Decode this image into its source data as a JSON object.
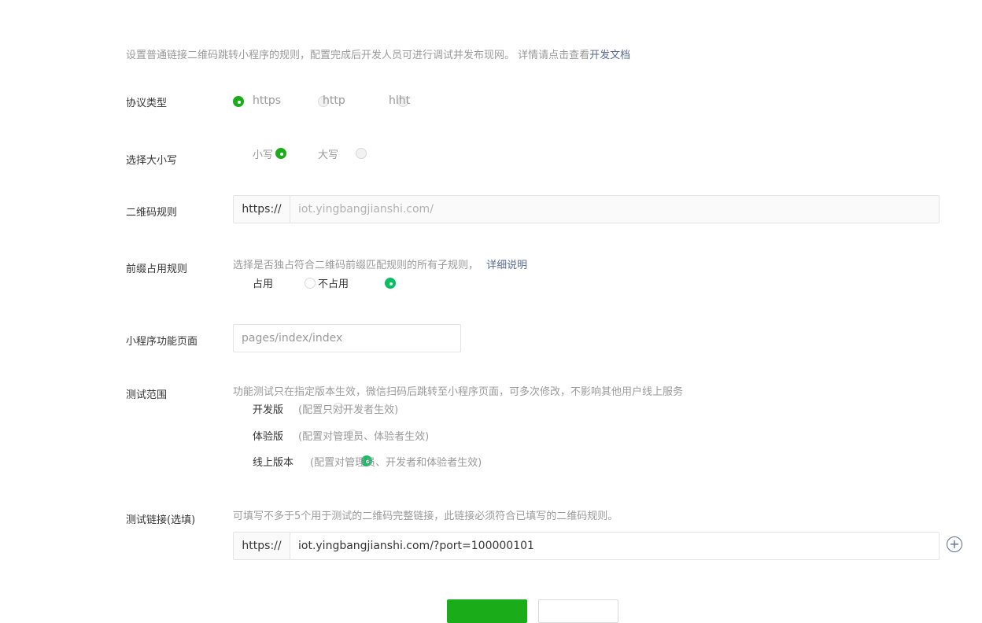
{
  "intro": {
    "text": "设置普通链接二维码跳转小程序的规则，配置完成后开发人员可进行调试并发布现网。 详情请点击查看",
    "link": "开发文档"
  },
  "protocol": {
    "label": "协议类型",
    "options": [
      "https",
      "http",
      "hlht"
    ],
    "selected": "https"
  },
  "case": {
    "label": "选择大小写",
    "options": [
      "小写",
      "大写"
    ],
    "selected": "小写"
  },
  "qr_rule": {
    "label": "二维码规则",
    "prefix": "https://",
    "value": "iot.yingbangjianshi.com/"
  },
  "prefix_rule": {
    "label": "前缀占用规则",
    "hint": "选择是否独占符合二维码前缀匹配规则的所有子规则，",
    "hint_link": "详细说明",
    "options": [
      "占用",
      "不占用"
    ],
    "selected": "不占用"
  },
  "page": {
    "label": "小程序功能页面",
    "placeholder": "pages/index/index"
  },
  "test_scope": {
    "label": "测试范围",
    "hint": "功能测试只在指定版本生效，微信扫码后跳转至小程序页面，可多次修改，不影响其他用户线上服务",
    "options": [
      {
        "label": "开发版",
        "desc": "(配置只对开发者生效)"
      },
      {
        "label": "体验版",
        "desc": "(配置对管理员、体验者生效)"
      },
      {
        "label": "线上版本",
        "desc": "(配置对管理员、开发者和体验者生效)"
      }
    ],
    "selected": "线上版本"
  },
  "test_link": {
    "label": "测试链接(选填)",
    "hint": "可填写不多于5个用于测试的二维码完整链接，此链接必须符合已填写的二维码规则。",
    "prefix": "https://",
    "value": "iot.yingbangjianshi.com/?port=100000101",
    "add_icon": "plus-circle-icon"
  },
  "colors": {
    "primary": "#1aad19",
    "radio_active": "#07c160",
    "link": "#576b95"
  }
}
